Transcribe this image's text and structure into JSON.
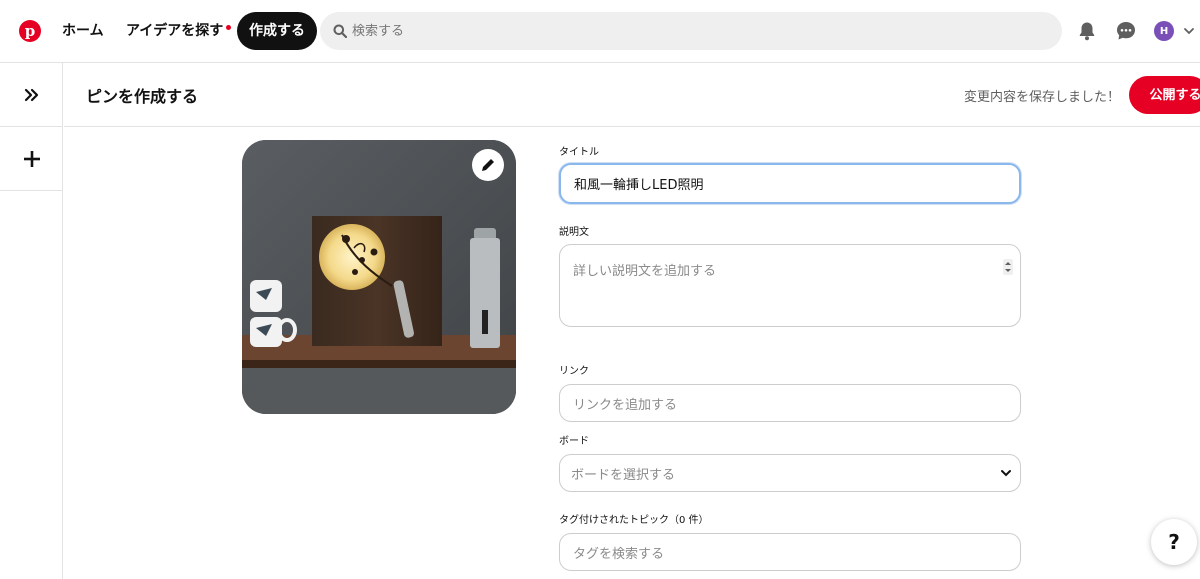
{
  "app": {
    "brand_color": "#e60023",
    "logo_icon": "pinterest-logo-icon"
  },
  "topnav": {
    "home": "ホーム",
    "explore": "アイデアを探す",
    "create": "作成する",
    "search_placeholder": "検索する",
    "avatar_initial": "H",
    "notification_icon": "bell-icon",
    "messages_icon": "chat-icon"
  },
  "sidebar": {
    "expand_icon": "double-chevron-right-icon",
    "add_icon": "plus-icon"
  },
  "header": {
    "title": "ピンを作成する",
    "saved_status": "変更内容を保存しました！",
    "publish_label": "公開する"
  },
  "form": {
    "title_label": "タイトル",
    "title_value": "和風一輪挿しLED照明",
    "description_label": "説明文",
    "description_placeholder": "詳しい説明文を追加する",
    "link_label": "リンク",
    "link_placeholder": "リンクを追加する",
    "board_label": "ボード",
    "board_placeholder": "ボードを選択する",
    "tags_label": "タグ付けされたトピック（0 件）",
    "tags_placeholder": "タグを検索する"
  },
  "help": {
    "label": "?"
  }
}
